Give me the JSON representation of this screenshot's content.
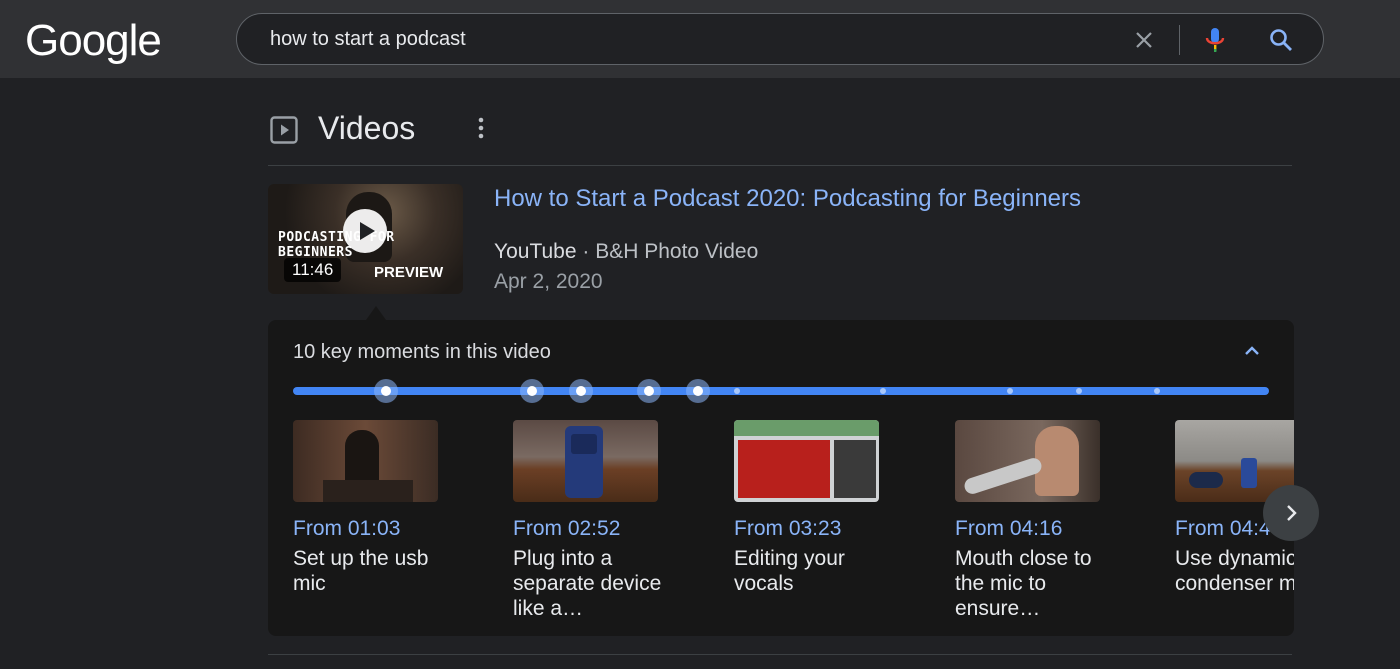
{
  "header": {
    "logo_text": "Google",
    "search": {
      "value": "how to start a podcast"
    }
  },
  "section": {
    "title": "Videos",
    "icons": [
      "video-play-icon",
      "more-vert-icon"
    ]
  },
  "video": {
    "title": "How to Start a Podcast 2020: Podcasting for Beginners",
    "source": "YouTube",
    "separator": " · ",
    "channel": "B&H Photo Video",
    "date": "Apr 2, 2020",
    "thumbnail_overlay": "PODCASTING FOR BEGINNERS",
    "duration": "11:46",
    "preview_label": "PREVIEW"
  },
  "key_moments": {
    "title": "10 key moments in this video",
    "markers": [
      {
        "position": 0.095,
        "highlighted": true
      },
      {
        "position": 0.245,
        "highlighted": true
      },
      {
        "position": 0.295,
        "highlighted": true
      },
      {
        "position": 0.365,
        "highlighted": true
      },
      {
        "position": 0.415,
        "highlighted": true
      },
      {
        "position": 0.455,
        "highlighted": false
      },
      {
        "position": 0.605,
        "highlighted": false
      },
      {
        "position": 0.735,
        "highlighted": false
      },
      {
        "position": 0.805,
        "highlighted": false
      },
      {
        "position": 0.885,
        "highlighted": false
      }
    ],
    "items": [
      {
        "time": "From 01:03",
        "desc": "Set up the usb mic"
      },
      {
        "time": "From 02:52",
        "desc": "Plug into a separate device like a…"
      },
      {
        "time": "From 03:23",
        "desc": "Editing your vocals"
      },
      {
        "time": "From 04:16",
        "desc": "Mouth close to the mic to ensure…"
      },
      {
        "time": "From 04:4",
        "desc": "Use dynamic or condenser mics"
      }
    ]
  },
  "colors": {
    "background": "#202124",
    "link": "#8ab4f8",
    "timeline": "#4285f4"
  }
}
